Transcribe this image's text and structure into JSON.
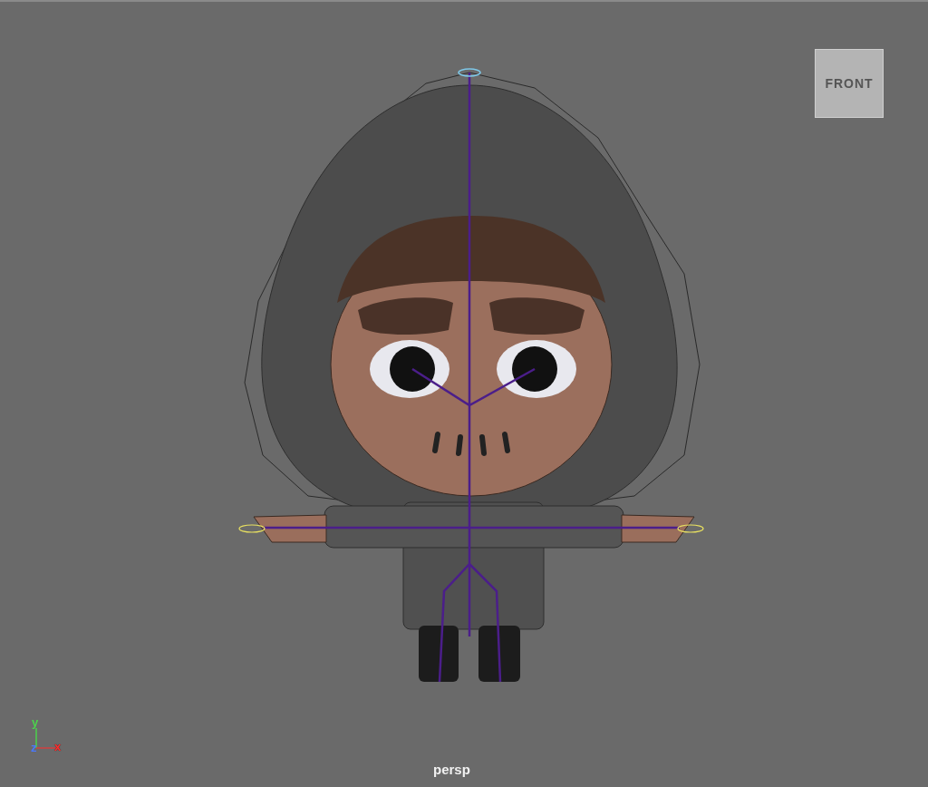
{
  "viewport": {
    "view_cube": {
      "label": "FRONT"
    },
    "axis_gizmo": {
      "y_label": "y",
      "z_label": "z",
      "x_label": "x"
    },
    "camera_label": "persp"
  }
}
